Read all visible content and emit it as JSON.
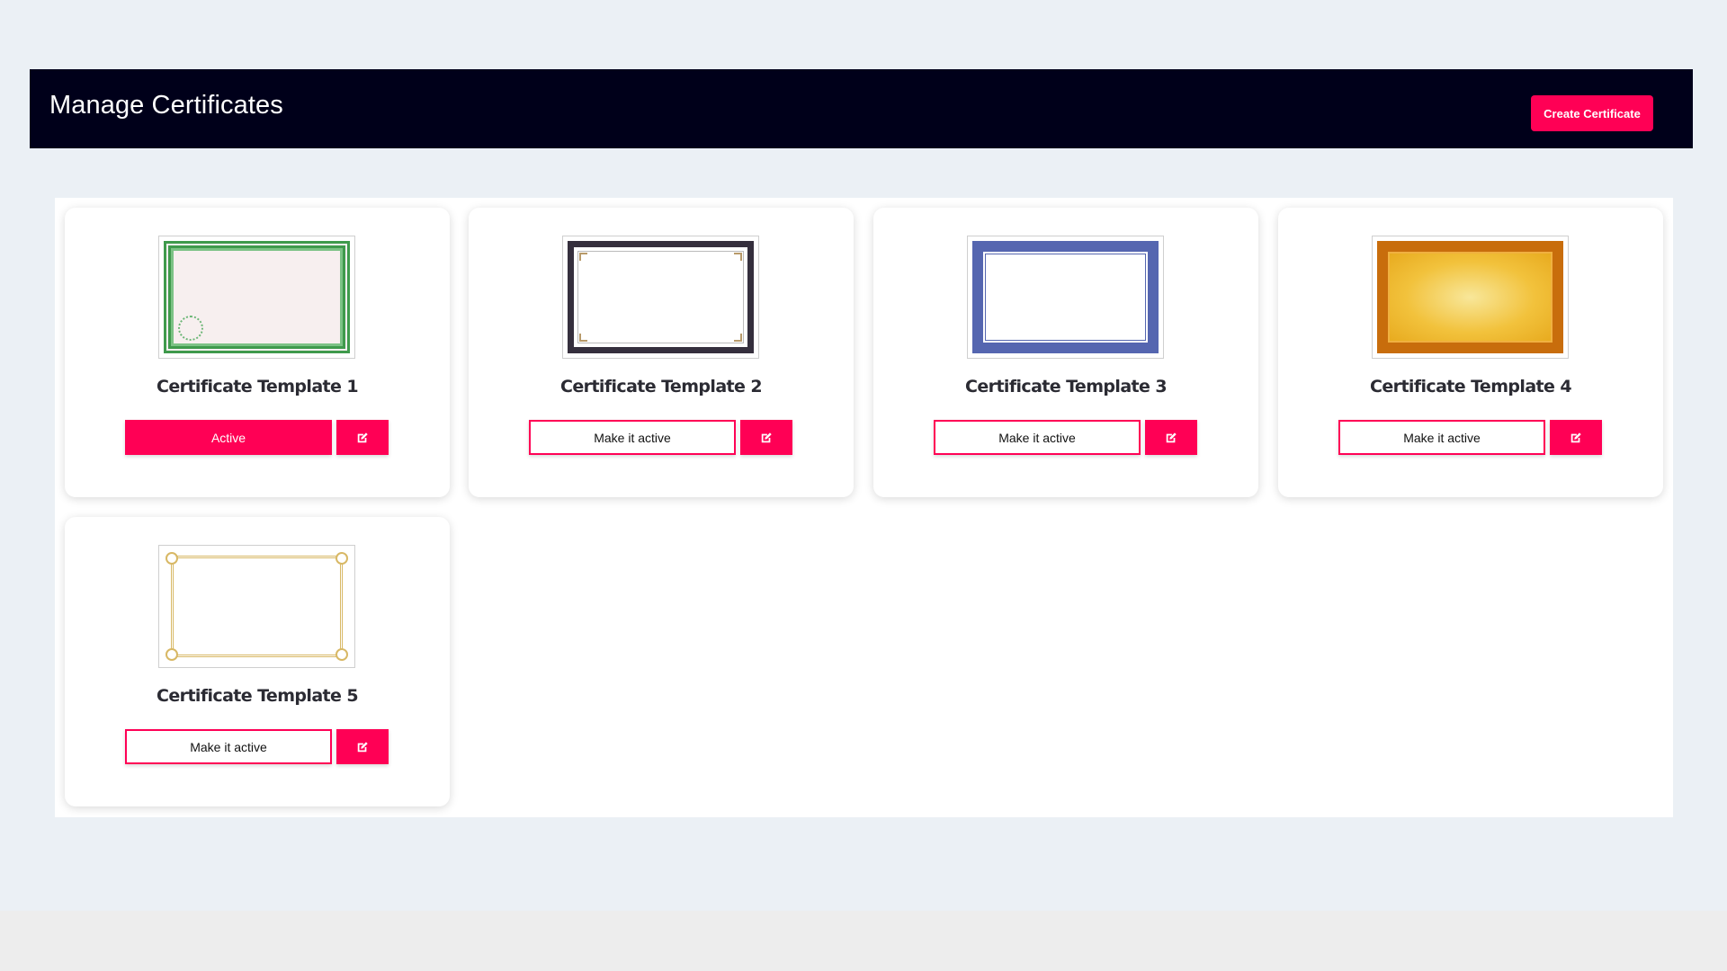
{
  "header": {
    "title": "Manage Certificates",
    "create_button_label": "Create Certificate"
  },
  "colors": {
    "accent": "#ff0055",
    "header_bg": "#00001a",
    "page_bg": "#ebf0f5"
  },
  "certificates": [
    {
      "title": "Certificate Template 1",
      "status_label": "Active",
      "is_active": true,
      "thumbnail": "green-guilloche-border",
      "edit_icon": "edit-icon"
    },
    {
      "title": "Certificate Template 2",
      "status_label": "Make it active",
      "is_active": false,
      "thumbnail": "dark-frame-gold-corners",
      "edit_icon": "edit-icon"
    },
    {
      "title": "Certificate Template 3",
      "status_label": "Make it active",
      "is_active": false,
      "thumbnail": "blue-rope-border",
      "edit_icon": "edit-icon"
    },
    {
      "title": "Certificate Template 4",
      "status_label": "Make it active",
      "is_active": false,
      "thumbnail": "gold-ornate-border",
      "edit_icon": "edit-icon"
    },
    {
      "title": "Certificate Template 5",
      "status_label": "Make it active",
      "is_active": false,
      "thumbnail": "gold-scroll-frame",
      "edit_icon": "edit-icon"
    }
  ]
}
